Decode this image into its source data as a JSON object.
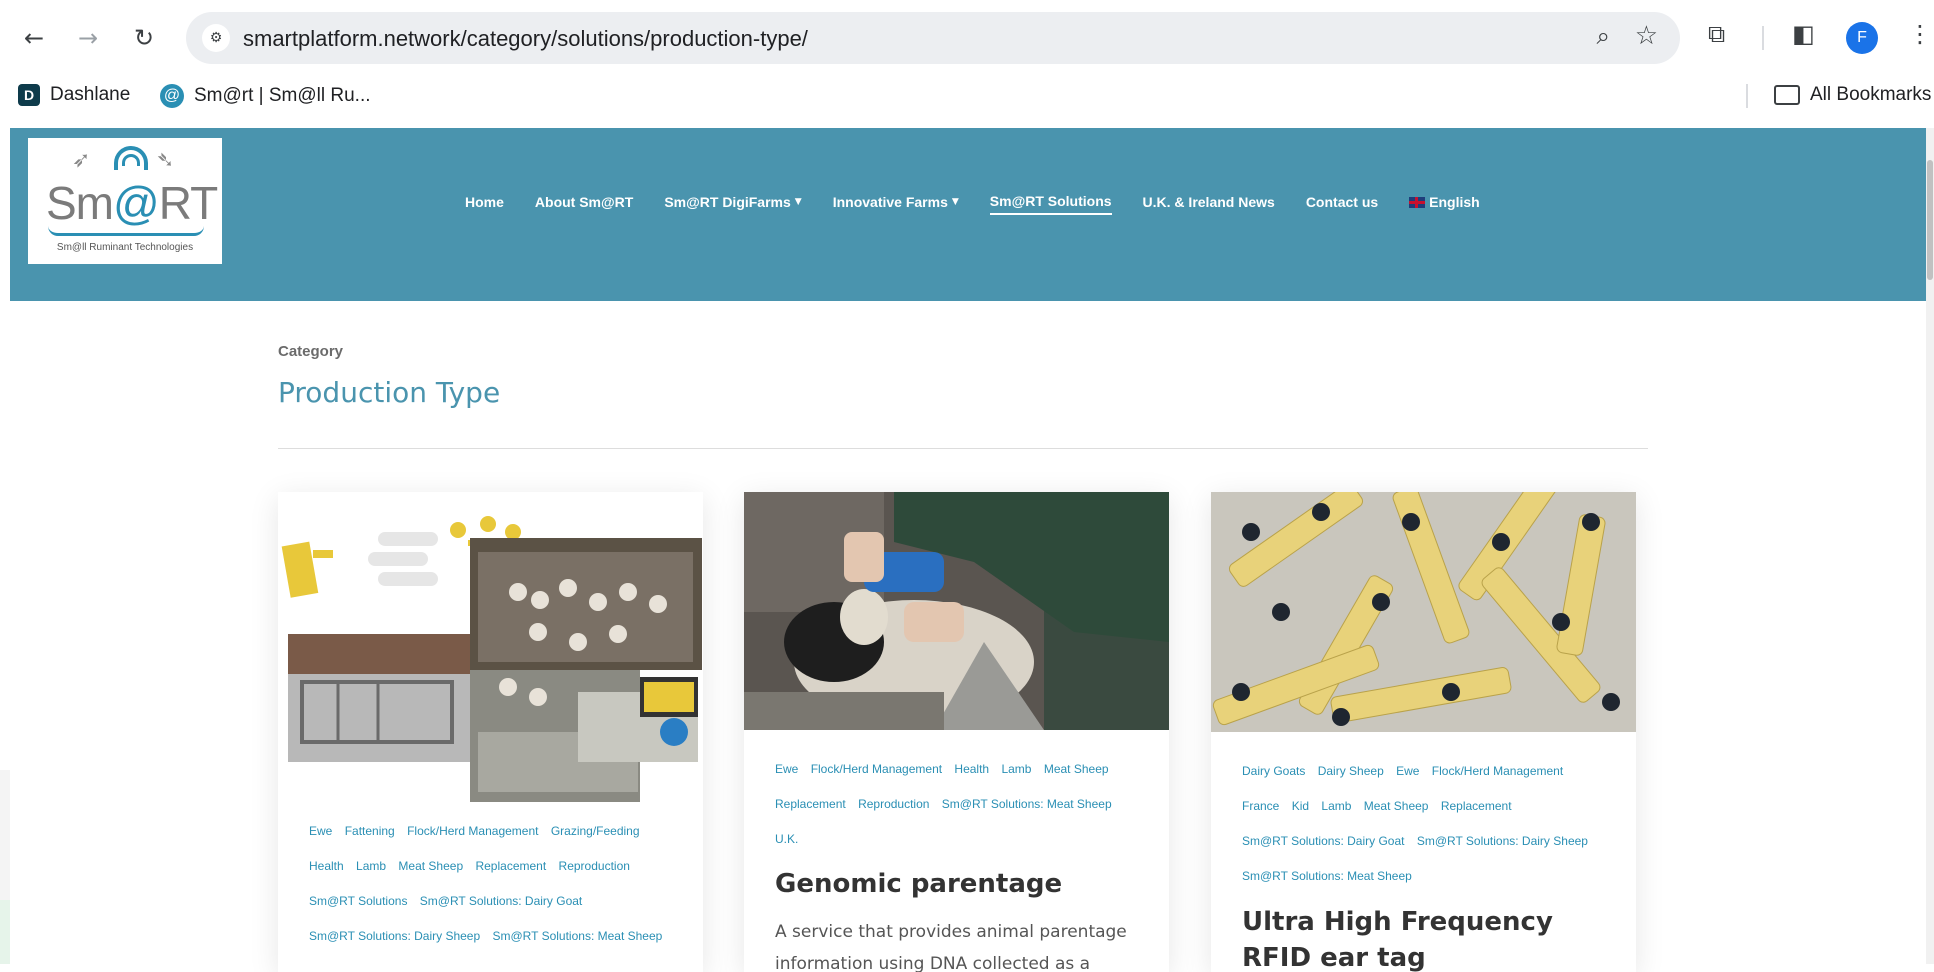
{
  "browser": {
    "url": "smartplatform.network/category/solutions/production-type/",
    "profile_initial": "F",
    "bookmarks": [
      {
        "label": "Dashlane"
      },
      {
        "label": "Sm@rt | Sm@ll Ru..."
      }
    ],
    "all_bookmarks": "All Bookmarks"
  },
  "site": {
    "logo": {
      "text": "Sm@RT",
      "tagline": "Sm@ll Ruminant Technologies"
    },
    "menu": [
      {
        "label": "Home"
      },
      {
        "label": "About Sm@RT"
      },
      {
        "label": "Sm@RT DigiFarms"
      },
      {
        "label": "Innovative Farms"
      },
      {
        "label": "Sm@RT Solutions"
      },
      {
        "label": "U.K. & Ireland News"
      },
      {
        "label": "Contact us"
      },
      {
        "label": "English"
      }
    ]
  },
  "page": {
    "category_label": "Category",
    "title": "Production Type"
  },
  "cards": [
    {
      "tags": [
        "Ewe",
        "Fattening",
        "Flock/Herd Management",
        "Grazing/Feeding",
        "Health",
        "Lamb",
        "Meat Sheep",
        "Replacement",
        "Reproduction",
        "Sm@RT Solutions",
        "Sm@RT Solutions: Dairy Goat",
        "Sm@RT Solutions: Dairy Sheep",
        "Sm@RT Solutions: Meat Sheep"
      ]
    },
    {
      "tags": [
        "Ewe",
        "Flock/Herd Management",
        "Health",
        "Lamb",
        "Meat Sheep",
        "Replacement",
        "Reproduction",
        "Sm@RT Solutions: Meat Sheep",
        "U.K."
      ],
      "title": "Genomic parentage",
      "excerpt": "A service that provides animal parentage information using DNA collected as a tissue"
    },
    {
      "tags": [
        "Dairy Goats",
        "Dairy Sheep",
        "Ewe",
        "Flock/Herd Management",
        "France",
        "Kid",
        "Lamb",
        "Meat Sheep",
        "Replacement",
        "Sm@RT Solutions: Dairy Goat",
        "Sm@RT Solutions: Dairy Sheep",
        "Sm@RT Solutions: Meat Sheep"
      ],
      "title": "Ultra High Frequency RFID ear tag"
    }
  ]
}
